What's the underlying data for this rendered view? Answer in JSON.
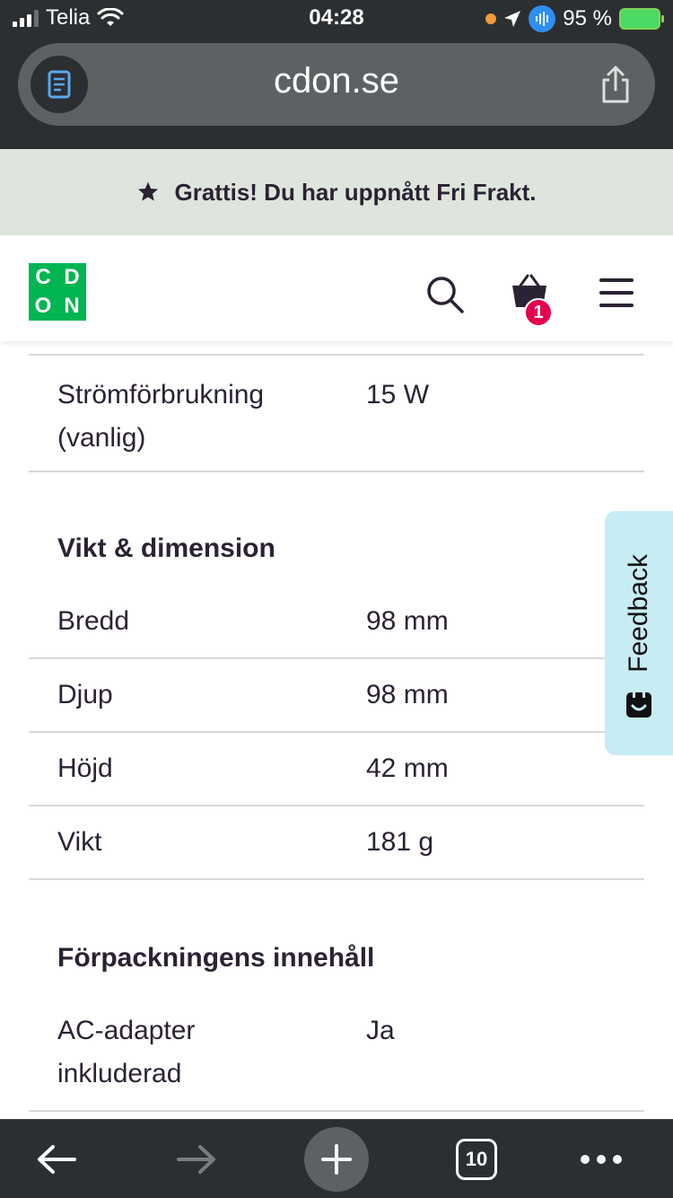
{
  "status_bar": {
    "carrier": "Telia",
    "time": "04:28",
    "battery": "95 %"
  },
  "browser": {
    "url": "cdon.se",
    "tabs_count": "10"
  },
  "promo": {
    "text": "Grattis! Du har uppnått Fri Frakt."
  },
  "header": {
    "logo_letters": [
      "C",
      "D",
      "O",
      "N"
    ],
    "cart_count": "1",
    "colors": {
      "logo_green": "#00b552",
      "badge": "#e4004f"
    }
  },
  "specs": {
    "top_row": {
      "key": "Strömförbrukning (vanlig)",
      "value": "15 W"
    },
    "section_weight": {
      "title": "Vikt & dimension",
      "rows": [
        {
          "key": "Bredd",
          "value": "98 mm"
        },
        {
          "key": "Djup",
          "value": "98 mm"
        },
        {
          "key": "Höjd",
          "value": "42 mm"
        },
        {
          "key": "Vikt",
          "value": "181 g"
        }
      ]
    },
    "section_package": {
      "title": "Förpackningens innehåll",
      "rows": [
        {
          "key": "AC-adapter inkluderad",
          "value": "Ja"
        }
      ]
    }
  },
  "feedback": {
    "label": "Feedback"
  }
}
